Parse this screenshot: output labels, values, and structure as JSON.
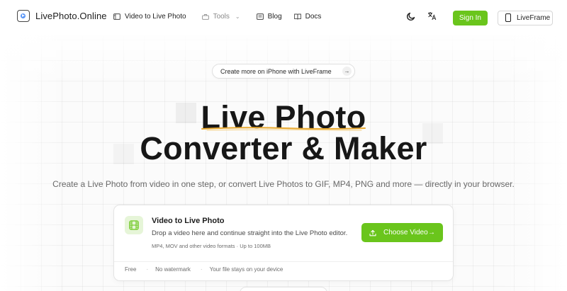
{
  "header": {
    "logo_text": "LivePhoto.Online",
    "nav": [
      {
        "label": "Video to Live Photo",
        "icon": "film-icon"
      },
      {
        "label": "Tools",
        "icon": "toolbox-icon",
        "has_dropdown": true
      },
      {
        "label": "Blog",
        "icon": "newspaper-icon"
      },
      {
        "label": "Docs",
        "icon": "book-icon"
      }
    ],
    "theme_icon": "moon-icon",
    "language_icon": "translate-icon",
    "sign_in_label": "Sign In",
    "liveframe_label": "LiveFrame"
  },
  "hero": {
    "pill_label": "Create more on iPhone with LiveFrame",
    "title_line1": "Live Photo",
    "title_line2": "Converter & Maker",
    "subtitle": "Create a Live Photo from video in one step, or convert Live Photos to GIF, MP4, PNG and more — directly in your browser."
  },
  "upload_card": {
    "title": "Video to Live Photo",
    "description": "Drop a video here and continue straight into the Live Photo editor.",
    "meta": "MP4, MOV and other video formats · Up to 100MB",
    "button_label": "Choose Video",
    "features": [
      "Free",
      "No watermark",
      "Your file stays on your device"
    ]
  },
  "colors": {
    "accent": "#6ac51c",
    "underline": "#e9a92e",
    "text": "#171717"
  }
}
